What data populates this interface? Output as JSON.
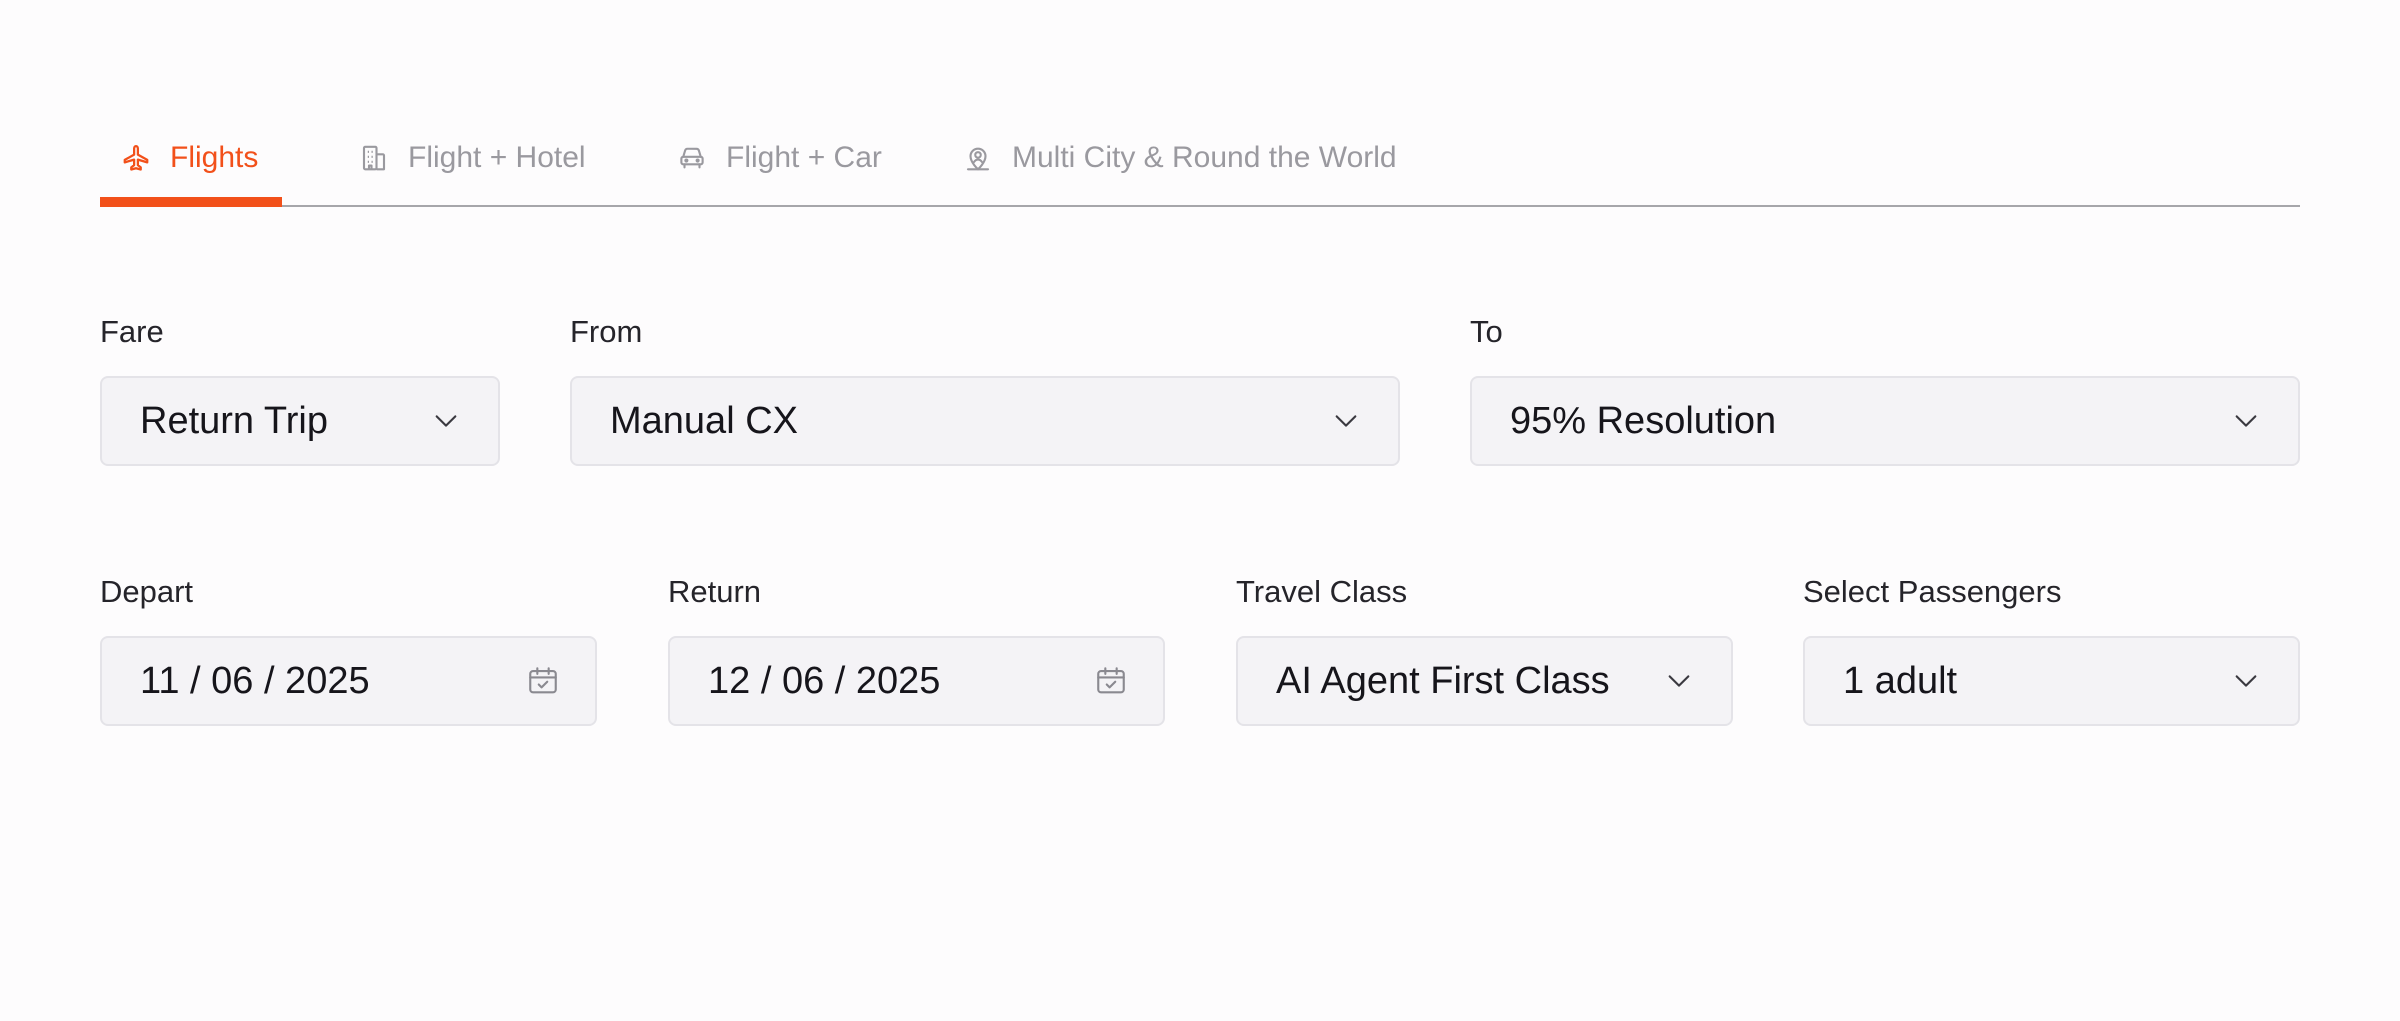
{
  "tabs": [
    {
      "label": "Flights",
      "icon": "plane-icon",
      "active": true
    },
    {
      "label": "Flight + Hotel",
      "icon": "building-icon",
      "active": false
    },
    {
      "label": "Flight + Car",
      "icon": "car-icon",
      "active": false
    },
    {
      "label": "Multi City & Round the World",
      "icon": "map-pin-user-icon",
      "active": false
    }
  ],
  "colors": {
    "accent": "#f2501a",
    "tab_inactive": "#9a999f",
    "field_bg": "#f4f3f6",
    "field_border": "#e4e3e8",
    "divider": "#a6a6aa"
  },
  "fare": {
    "label": "Fare",
    "value": "Return Trip"
  },
  "from": {
    "label": "From",
    "value": "Manual CX"
  },
  "to": {
    "label": "To",
    "value": "95% Resolution"
  },
  "depart": {
    "label": "Depart",
    "value": "11 / 06 / 2025"
  },
  "return": {
    "label": "Return",
    "value": "12 / 06 / 2025"
  },
  "travel_class": {
    "label": "Travel Class",
    "value": "AI Agent First Class"
  },
  "passengers": {
    "label": "Select Passengers",
    "value": "1 adult"
  }
}
